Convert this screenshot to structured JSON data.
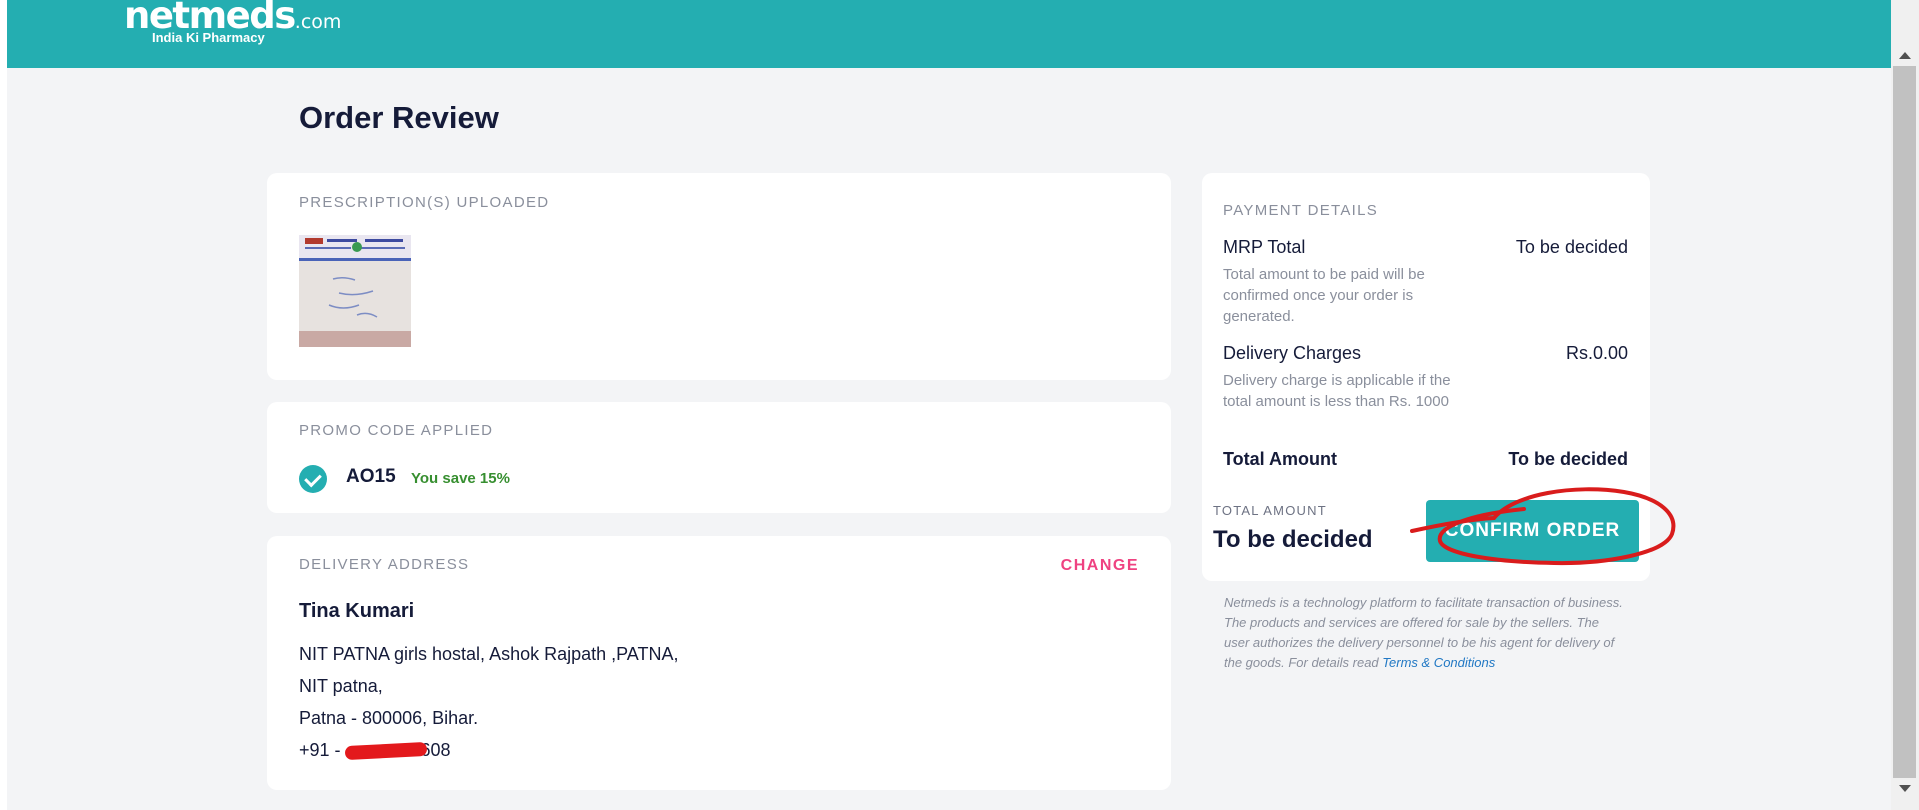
{
  "header": {
    "logo_main": "netmeds",
    "logo_suffix": ".com",
    "logo_tagline": "India Ki Pharmacy",
    "brand_color": "#24aeb1"
  },
  "page_title": "Order Review",
  "prescription": {
    "label": "PRESCRIPTION(S) UPLOADED"
  },
  "promo": {
    "label": "PROMO CODE APPLIED",
    "code": "AO15",
    "savings": "You save 15%",
    "icon": "check-circle-icon"
  },
  "delivery": {
    "label": "DELIVERY ADDRESS",
    "change_label": "CHANGE",
    "name": "Tina Kumari",
    "lines": [
      "NIT PATNA girls hostal, Ashok Rajpath ,PATNA,",
      "NIT patna,",
      "Patna - 800006, Bihar."
    ],
    "phone_prefix": "+91 -",
    "phone_suffix": "608"
  },
  "payment": {
    "label": "PAYMENT DETAILS",
    "mrp_title": "MRP Total",
    "mrp_value": "To be decided",
    "mrp_note": "Total amount to be paid will be confirmed once your order is generated.",
    "delivery_title": "Delivery Charges",
    "delivery_value": "Rs.0.00",
    "delivery_note": "Delivery charge is applicable if the total amount is less than Rs. 1000",
    "total_title": "Total Amount",
    "total_value": "To be decided",
    "footer_label": "TOTAL AMOUNT",
    "footer_value": "To be decided",
    "confirm_label": "CONFIRM ORDER"
  },
  "disclaimer": {
    "text": "Netmeds is a technology platform to facilitate transaction of business. The products and services are offered for sale by the sellers. The user authorizes the delivery personnel to be his agent for delivery of the goods. For details read",
    "link": "Terms & Conditions"
  }
}
